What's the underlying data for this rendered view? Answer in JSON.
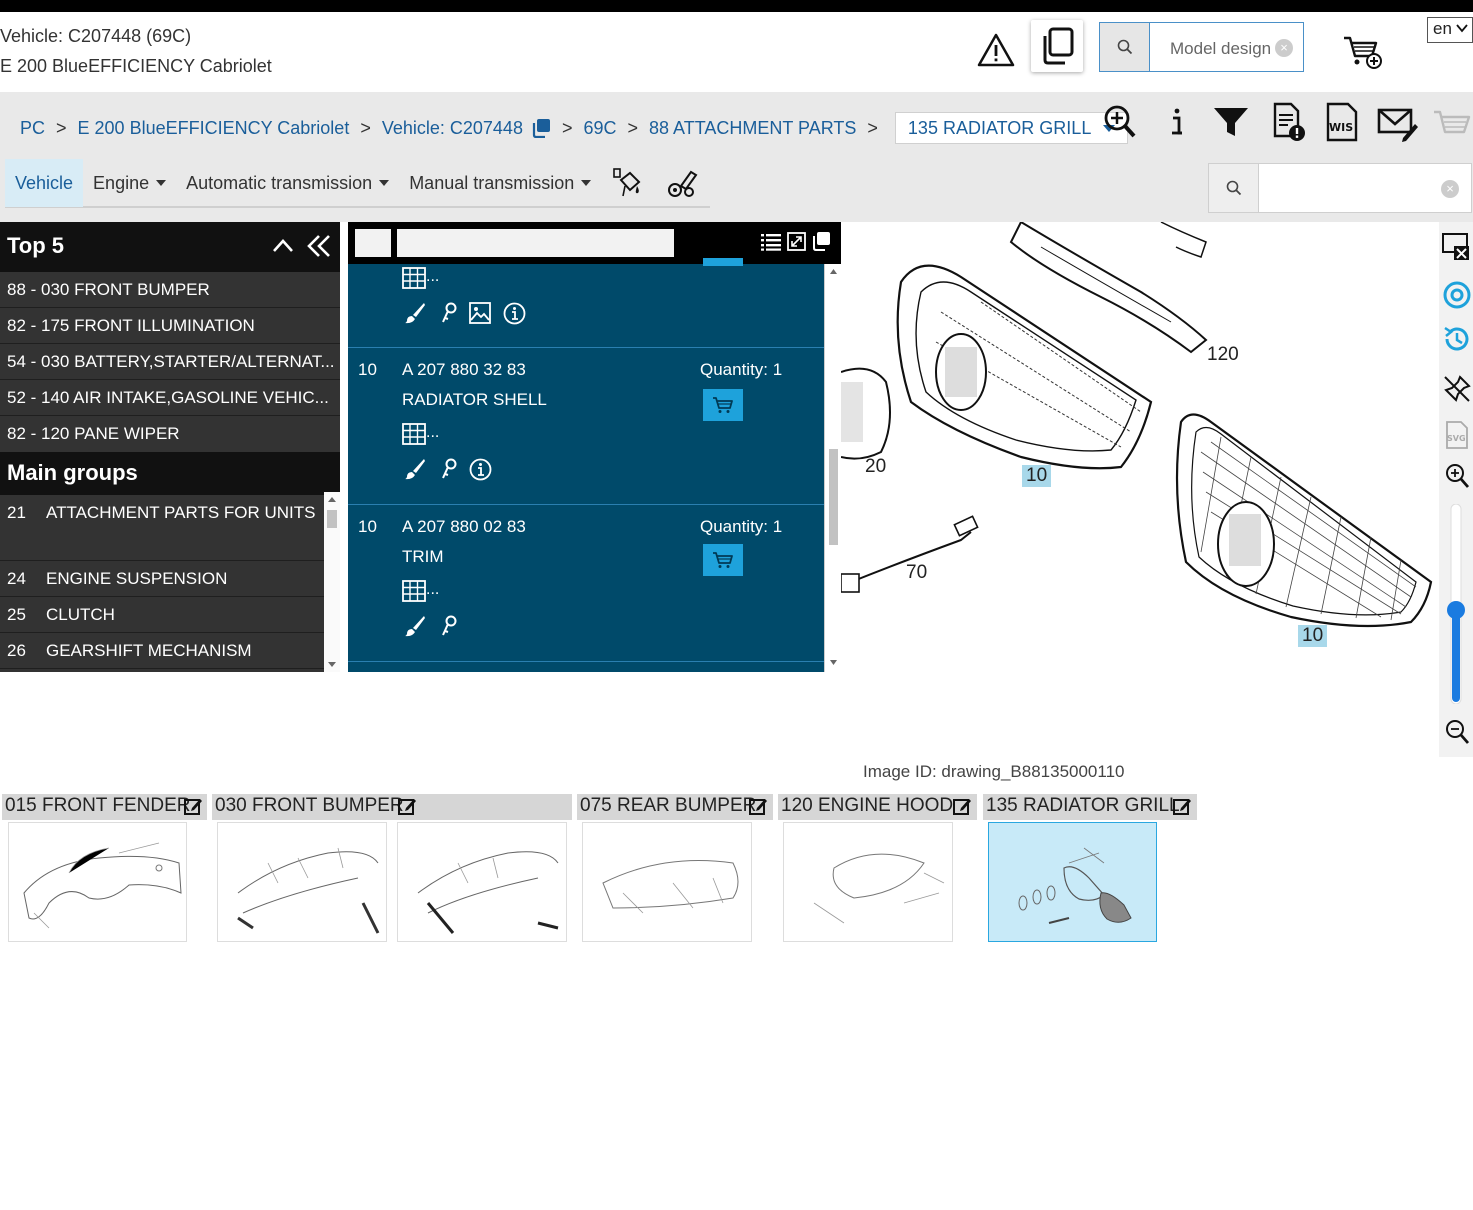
{
  "header": {
    "vehicle_line1": "Vehicle: C207448 (69C)",
    "vehicle_line2": "E 200 BlueEFFICIENCY Cabriolet",
    "search_placeholder": "Model design",
    "language": "en"
  },
  "breadcrumb": {
    "items": [
      "PC",
      "E 200 BlueEFFICIENCY Cabriolet",
      "Vehicle: C207448",
      "69C",
      "88 ATTACHMENT PARTS"
    ],
    "current": "135 RADIATOR GRILL"
  },
  "tabs": [
    {
      "label": "Vehicle",
      "active": true
    },
    {
      "label": "Engine"
    },
    {
      "label": "Automatic transmission"
    },
    {
      "label": "Manual transmission"
    }
  ],
  "top5": {
    "title": "Top 5",
    "items": [
      "88 - 030 FRONT BUMPER",
      "82 - 175 FRONT ILLUMINATION",
      "54 - 030 BATTERY,STARTER/ALTERNAT...",
      "52 - 140 AIR INTAKE,GASOLINE VEHIC...",
      "82 - 120 PANE WIPER"
    ]
  },
  "main_groups": {
    "title": "Main groups",
    "items": [
      {
        "num": "21",
        "label": "ATTACHMENT PARTS FOR UNITS"
      },
      {
        "num": "24",
        "label": "ENGINE SUSPENSION"
      },
      {
        "num": "25",
        "label": "CLUTCH"
      },
      {
        "num": "26",
        "label": "GEARSHIFT MECHANISM"
      }
    ]
  },
  "parts": [
    {
      "pos": "10",
      "number": "A 207 880 32 83",
      "name": "RADIATOR SHELL",
      "quantity_label": "Quantity:",
      "quantity": "1"
    },
    {
      "pos": "10",
      "number": "A 207 880 02 83",
      "name": "TRIM",
      "quantity_label": "Quantity:",
      "quantity": "1"
    }
  ],
  "table_ellipsis": "...",
  "drawing": {
    "callouts": [
      "120",
      "20",
      "10",
      "70",
      "10"
    ],
    "image_id": "Image ID: drawing_B88135000110"
  },
  "thumbnails": [
    {
      "label": "015 FRONT FENDER"
    },
    {
      "label": "030 FRONT BUMPER"
    },
    {
      "label": "075 REAR BUMPER"
    },
    {
      "label": "120 ENGINE HOOD"
    },
    {
      "label": "135 RADIATOR GRILL",
      "selected": true
    }
  ],
  "colors": {
    "accent": "#1ea2db",
    "link": "#1a5e9a",
    "parts_bg": "#004a6a",
    "highlight": "#a8d8ea"
  }
}
